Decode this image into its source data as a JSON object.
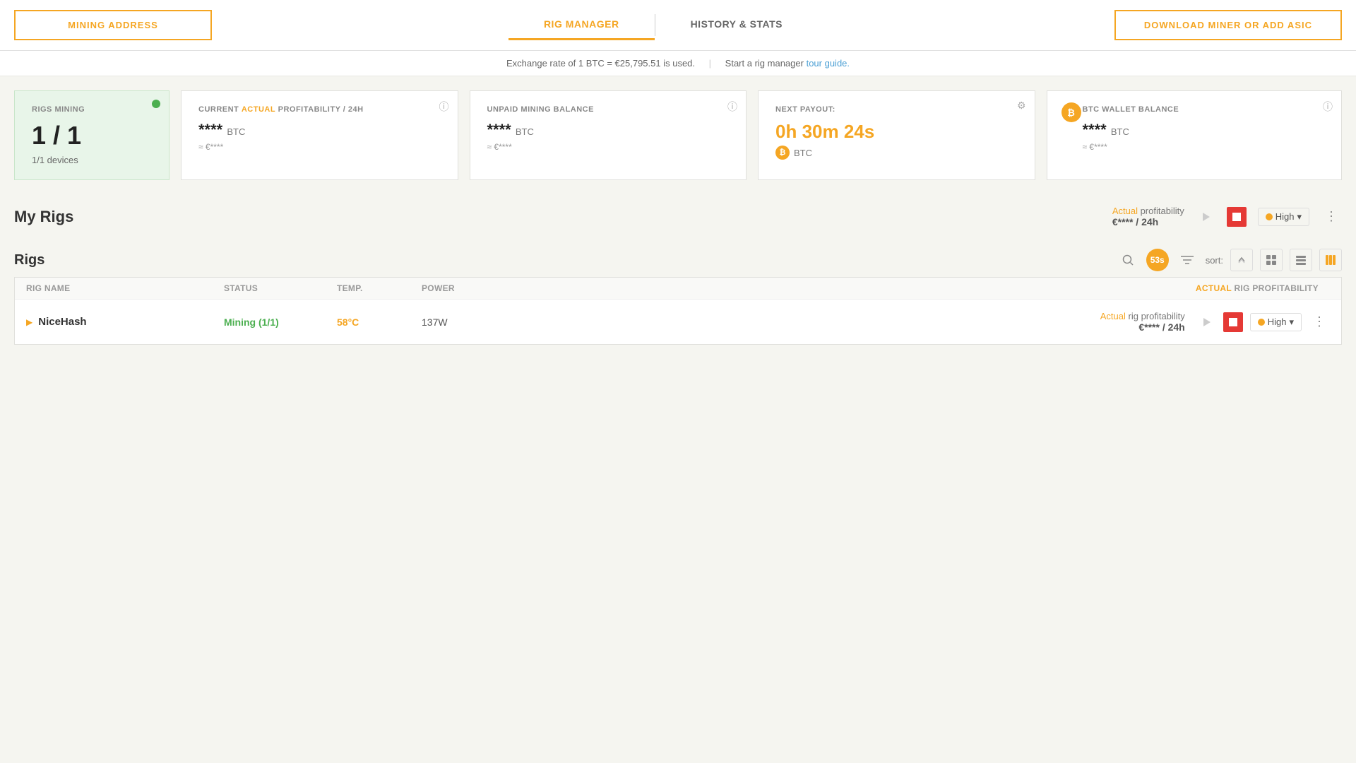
{
  "nav": {
    "mining_address_label": "MINING ADDRESS",
    "tab_rig_manager": "RIG MANAGER",
    "tab_history_stats": "HISTORY & STATS",
    "download_label": "DOWNLOAD MINER OR ADD ASIC"
  },
  "exchange_bar": {
    "text": "Exchange rate of 1 BTC = €25,795.51 is used.",
    "separator": "|",
    "guide_text": "Start a rig manager",
    "guide_link": "tour guide."
  },
  "cards": {
    "rigs_mining": {
      "label": "RIGS MINING",
      "value": "1 / 1",
      "devices": "1/1 devices"
    },
    "profitability": {
      "label_prefix": "CURRENT ",
      "label_highlight": "ACTUAL",
      "label_suffix": " PROFITABILITY / 24H",
      "value": "****",
      "currency": "BTC",
      "approx": "≈ €****"
    },
    "mining_balance": {
      "label": "UNPAID MINING BALANCE",
      "value": "****",
      "currency": "BTC",
      "approx": "≈ €****"
    },
    "next_payout": {
      "label": "NEXT PAYOUT:",
      "time": "0h 30m 24s",
      "currency": "BTC",
      "btc_symbol": "₿"
    },
    "wallet_balance": {
      "label": "BTC WALLET BALANCE",
      "value": "****",
      "currency": "BTC",
      "approx": "≈ €****",
      "btc_symbol": "₿"
    }
  },
  "my_rigs": {
    "title": "My Rigs",
    "profitability_label": "Actual profitability",
    "profitability_actual": "Actual",
    "profitability_amount": "€**** / 24h",
    "high_label": "High",
    "stop_icon": "■"
  },
  "rigs": {
    "title": "Rigs",
    "timer": "53s",
    "sort_label": "sort:",
    "columns": {
      "rig_name": "Rig name",
      "status": "Status",
      "temp": "Temp.",
      "power": "Power",
      "profitability": "Actual rig profitability"
    },
    "items": [
      {
        "name": "NiceHash",
        "status": "Mining (1/1)",
        "temp": "58°C",
        "power": "137W",
        "profitability_label": "Actual rig profitability",
        "profitability_actual": "Actual",
        "profitability_amount": "€**** / 24h",
        "high_label": "High"
      }
    ]
  }
}
